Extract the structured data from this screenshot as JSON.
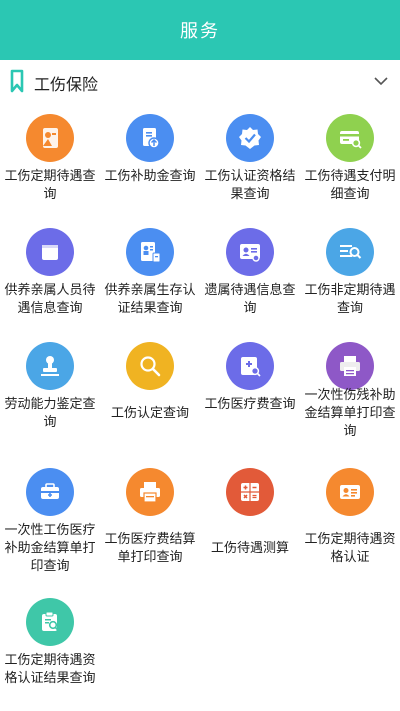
{
  "header": {
    "title": "服务"
  },
  "section": {
    "title": "工伤保险",
    "icon": "bookmark-icon",
    "toggle_icon": "chevron-down-icon"
  },
  "items": [
    {
      "label": "工伤定期待遇查询",
      "color": "#f5892f",
      "icon": "person-card-icon"
    },
    {
      "label": "工伤补助金查询",
      "color": "#4b8ef1",
      "icon": "document-upload-icon"
    },
    {
      "label": "工伤认证资格结果查询",
      "color": "#4b8ef1",
      "icon": "verified-badge-icon"
    },
    {
      "label": "工伤待遇支付明细查询",
      "color": "#8fd14f",
      "icon": "card-search-icon"
    },
    {
      "label": "供养亲属人员待遇信息查询",
      "color": "#6c6ce8",
      "icon": "folder-icon"
    },
    {
      "label": "供养亲属生存认证结果查询",
      "color": "#4b8ef1",
      "icon": "id-document-icon"
    },
    {
      "label": "遗属待遇信息查询",
      "color": "#6c6ce8",
      "icon": "profile-search-icon"
    },
    {
      "label": "工伤非定期待遇查询",
      "color": "#4ba6e6",
      "icon": "list-search-icon"
    },
    {
      "label": "劳动能力鉴定查询",
      "color": "#4ba6e6",
      "icon": "stamp-icon"
    },
    {
      "label": "工伤认定查询",
      "color": "#f0b322",
      "icon": "magnifier-icon"
    },
    {
      "label": "工伤医疗费查询",
      "color": "#6c6ce8",
      "icon": "medical-search-icon"
    },
    {
      "label": "一次性伤残补助金结算单打印查询",
      "color": "#8e58c7",
      "icon": "printer-doc-icon"
    },
    {
      "label": "一次性工伤医疗补助金结算单打印查询",
      "color": "#4b8ef1",
      "icon": "medical-kit-icon"
    },
    {
      "label": "工伤医疗费结算单打印查询",
      "color": "#f5892f",
      "icon": "printer-icon"
    },
    {
      "label": "工伤待遇测算",
      "color": "#e25a39",
      "icon": "calculator-icon"
    },
    {
      "label": "工伤定期待遇资格认证",
      "color": "#f5892f",
      "icon": "id-card-icon"
    },
    {
      "label": "工伤定期待遇资格认证结果查询",
      "color": "#3fc7a8",
      "icon": "clipboard-search-icon"
    }
  ]
}
